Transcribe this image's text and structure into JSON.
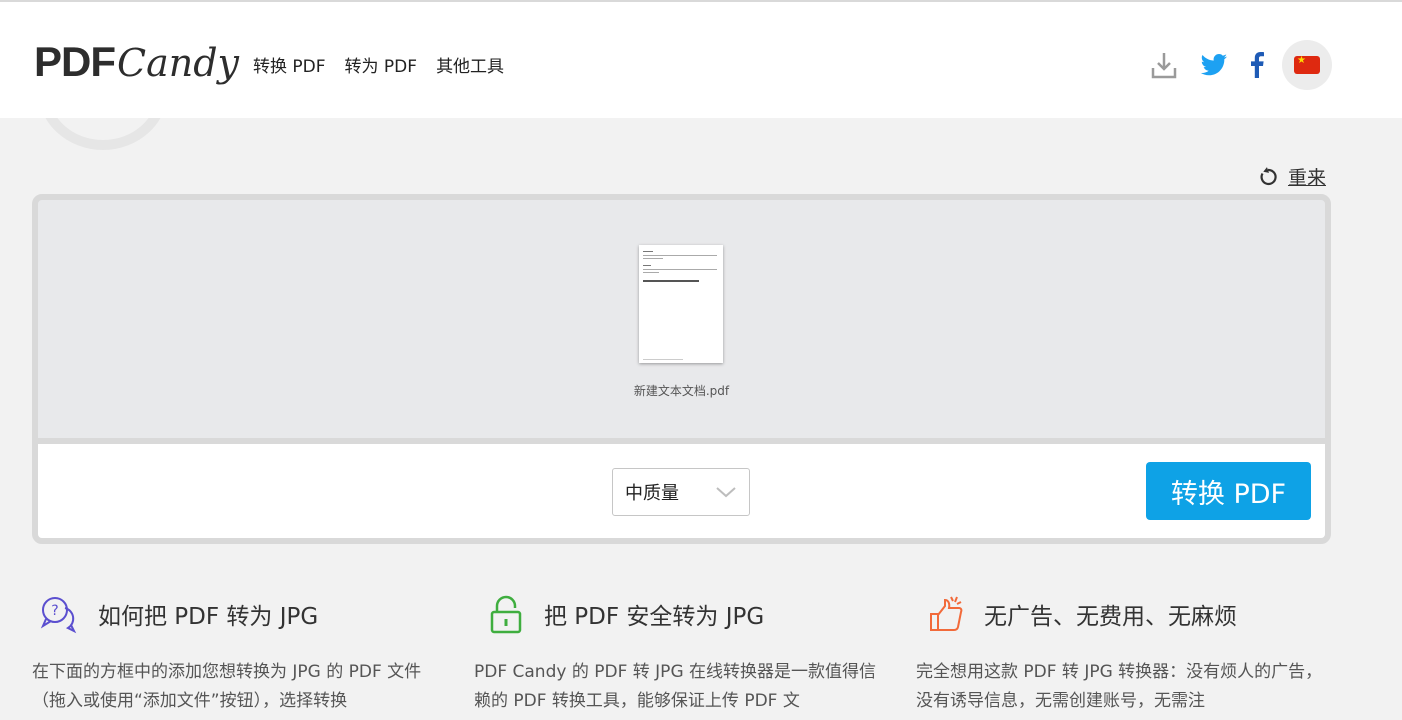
{
  "header": {
    "logo_pdf": "PDF",
    "logo_candy": "Candy",
    "nav": [
      "转换 PDF",
      "转为 PDF",
      "其他工具"
    ],
    "icons": [
      "download-icon",
      "twitter-icon",
      "facebook-icon",
      "china-flag-icon"
    ],
    "colors": {
      "twitter": "#1da1f2",
      "facebook": "#1e5bb6"
    }
  },
  "toolbar": {
    "restart_label": "重来"
  },
  "document": {
    "file_name": "新建文本文档.pdf"
  },
  "actions": {
    "quality_selected": "中质量",
    "convert_label": "转换 PDF",
    "accent": "#0ea2e6"
  },
  "features": [
    {
      "icon": "question-chat-icon",
      "title": "如何把 PDF 转为 JPG",
      "body": "在下面的方框中的添加您想转换为 JPG 的 PDF 文件（拖入或使用“添加文件”按钮），选择转换"
    },
    {
      "icon": "lock-icon",
      "title": "把 PDF 安全转为 JPG",
      "body": "PDF Candy 的 PDF 转 JPG 在线转换器是一款值得信赖的 PDF 转换工具，能够保证上传 PDF 文"
    },
    {
      "icon": "thumbs-up-icon",
      "title": "无广告、无费用、无麻烦",
      "body": "完全想用这款 PDF 转 JPG 转换器：没有烦人的广告，没有诱导信息，无需创建账号，无需注"
    }
  ]
}
